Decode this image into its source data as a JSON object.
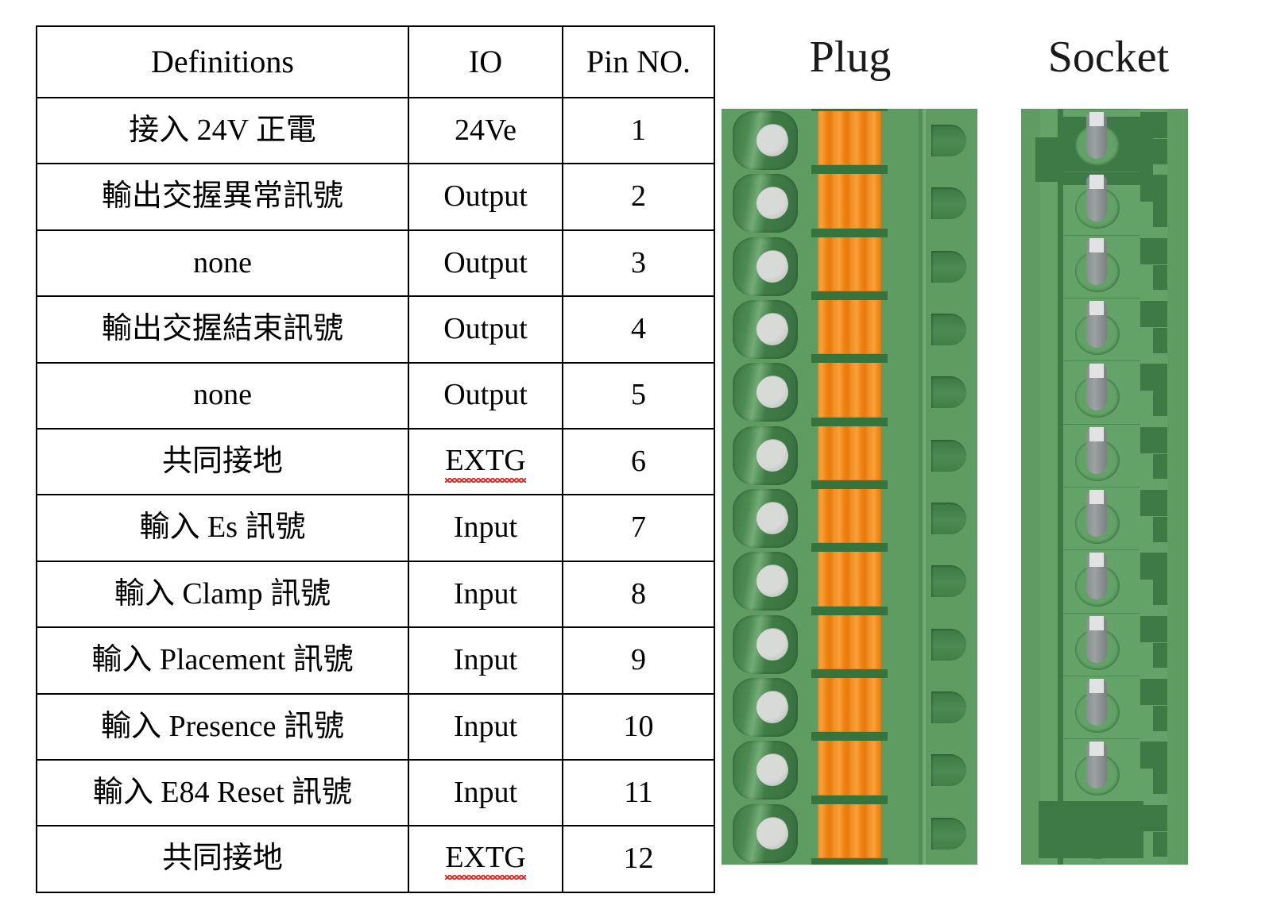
{
  "table": {
    "headers": [
      "Definitions",
      "IO",
      "Pin NO."
    ],
    "rows": [
      {
        "definition": "接入 24V 正電",
        "io": "24Ve",
        "io_misspelled": false,
        "pin": "1"
      },
      {
        "definition": "輸出交握異常訊號",
        "io": "Output",
        "io_misspelled": false,
        "pin": "2"
      },
      {
        "definition": "none",
        "io": "Output",
        "io_misspelled": false,
        "pin": "3"
      },
      {
        "definition": "輸出交握結束訊號",
        "io": "Output",
        "io_misspelled": false,
        "pin": "4"
      },
      {
        "definition": "none",
        "io": "Output",
        "io_misspelled": false,
        "pin": "5"
      },
      {
        "definition": "共同接地",
        "io": "EXTG",
        "io_misspelled": true,
        "pin": "6"
      },
      {
        "definition": "輸入 Es 訊號",
        "io": "Input",
        "io_misspelled": false,
        "pin": "7"
      },
      {
        "definition": "輸入 Clamp 訊號",
        "io": "Input",
        "io_misspelled": false,
        "pin": "8"
      },
      {
        "definition": "輸入 Placement 訊號",
        "io": "Input",
        "io_misspelled": false,
        "pin": "9"
      },
      {
        "definition": "輸入 Presence 訊號",
        "io": "Input",
        "io_misspelled": false,
        "pin": "10"
      },
      {
        "definition": "輸入 E84 Reset 訊號",
        "io": "Input",
        "io_misspelled": false,
        "pin": "11"
      },
      {
        "definition": "共同接地",
        "io": "EXTG",
        "io_misspelled": true,
        "pin": "12"
      }
    ]
  },
  "figures": {
    "plug": {
      "label": "Plug",
      "terminal_count": 12,
      "contact_count": 12,
      "pin_opening_count": 12
    },
    "socket": {
      "label": "Socket",
      "contact_count": 12
    }
  },
  "colors": {
    "connector_body_green": "#5e9c62",
    "connector_body_dark_green": "#3e7a45",
    "contact_orange": "#ef8413",
    "screw_gray": "#c3c7c2",
    "pin_metal_gray": "#8e8b95",
    "table_border": "#000000",
    "text": "#000000",
    "spellcheck_red": "#e8201a",
    "page_background": "#ffffff"
  }
}
